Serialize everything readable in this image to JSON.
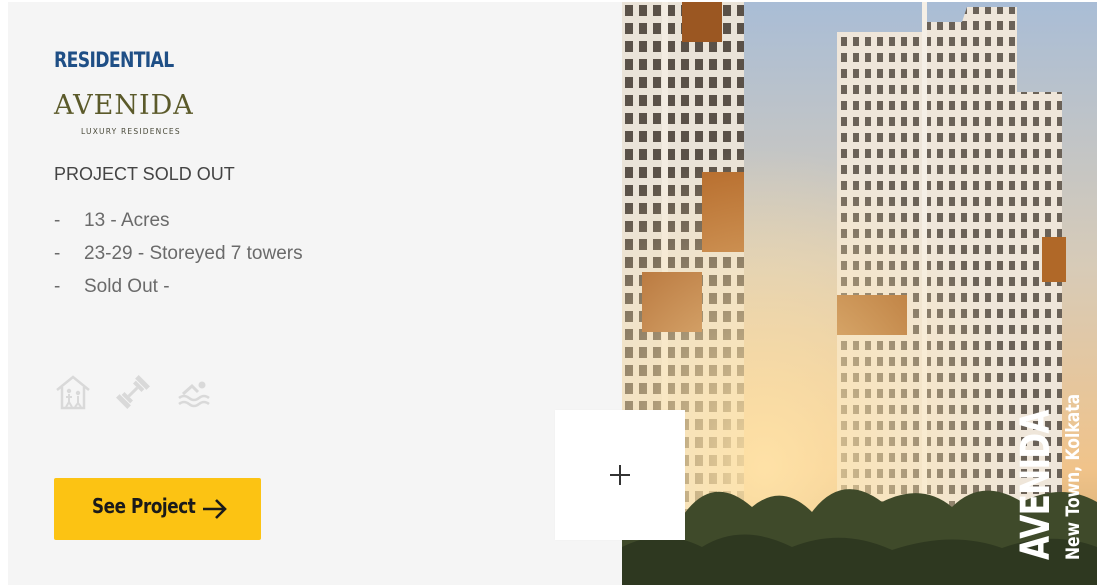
{
  "project": {
    "category": "RESIDENTIAL",
    "logo_text": "AVENIDA",
    "logo_subtext": "LUXURY RESIDENCES",
    "status": "PROJECT SOLD OUT",
    "facts": [
      {
        "dash": "-",
        "text": "13 - Acres"
      },
      {
        "dash": "-",
        "text": "23-29 - Storeyed 7 towers"
      },
      {
        "dash": "-",
        "text": "Sold Out -"
      }
    ],
    "amenities": [
      {
        "icon": "clubhouse-icon"
      },
      {
        "icon": "gym-dumbbell-icon"
      },
      {
        "icon": "swimming-icon"
      }
    ],
    "cta_label": "See Project",
    "cta_icon": "arrow-right-icon"
  },
  "image": {
    "caption_name": "AVENIDA",
    "caption_location": "New Town, Kolkata"
  },
  "expand_button": {
    "icon": "plus-icon"
  },
  "colors": {
    "category": "#1f4f86",
    "cta_background": "#fcc313",
    "card_background": "#f5f5f5",
    "logo": "#5b5a2a"
  }
}
